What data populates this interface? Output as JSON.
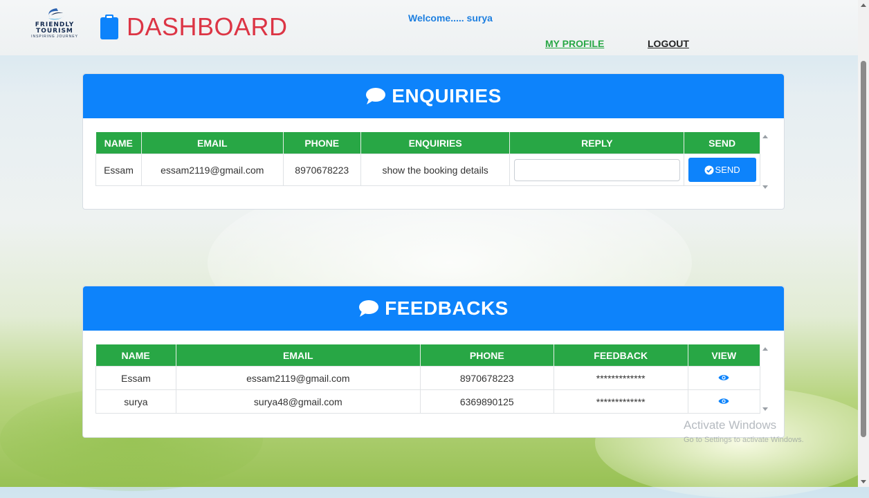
{
  "header": {
    "logo_line1": "FRIENDLY",
    "logo_line2": "TOURISM",
    "logo_tagline": "INSPIRING JOURNEY",
    "dashboard_title": "DASHBOARD",
    "welcome_text": "Welcome..... surya",
    "nav_profile": "MY PROFILE",
    "nav_logout": "LOGOUT"
  },
  "enquiries": {
    "title": "ENQUIRIES",
    "columns": [
      "NAME",
      "EMAIL",
      "PHONE",
      "ENQUIRIES",
      "REPLY",
      "SEND"
    ],
    "rows": [
      {
        "name": "Essam",
        "email": "essam2119@gmail.com",
        "phone": "8970678223",
        "enquiry": "show the booking details",
        "reply_value": "",
        "send_label": "SEND"
      }
    ]
  },
  "feedbacks": {
    "title": "FEEDBACKS",
    "columns": [
      "NAME",
      "EMAIL",
      "PHONE",
      "FEEDBACK",
      "VIEW"
    ],
    "rows": [
      {
        "name": "Essam",
        "email": "essam2119@gmail.com",
        "phone": "8970678223",
        "feedback": "*************"
      },
      {
        "name": "surya",
        "email": "surya48@gmail.com",
        "phone": "6369890125",
        "feedback": "*************"
      }
    ]
  },
  "watermark": {
    "line1": "Activate Windows",
    "line2": "Go to Settings to activate Windows."
  },
  "colors": {
    "primary_blue": "#0d83fb",
    "header_green": "#28a745",
    "title_red": "#dc3545"
  },
  "icons": {
    "logo": "friendly-tourism-swoosh",
    "dashboard": "clipboard-icon",
    "section": "comment-bubble-icon",
    "send": "check-circle-icon",
    "view": "eye-icon"
  }
}
